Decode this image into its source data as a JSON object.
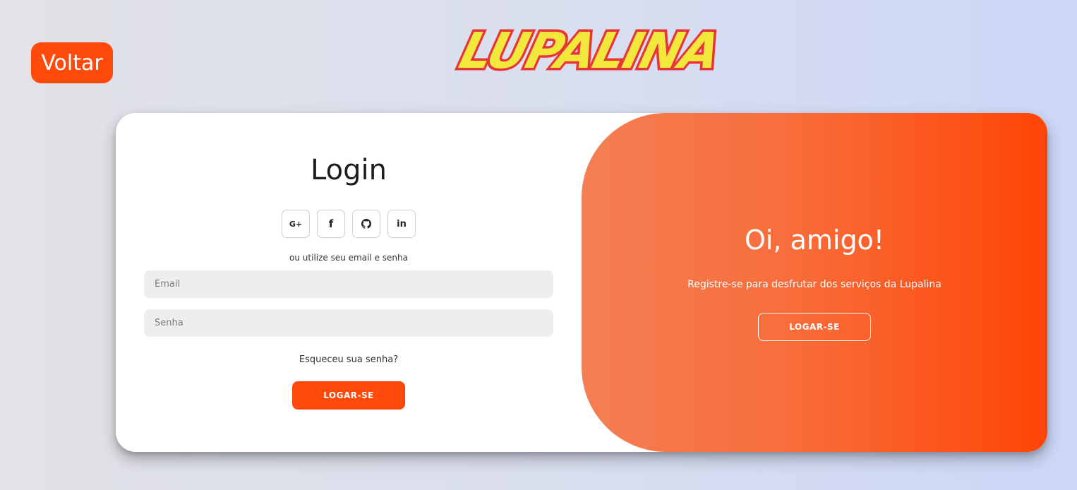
{
  "header": {
    "back_label": "Voltar",
    "logo_text": "LUPALINA"
  },
  "login": {
    "title": "Login",
    "social": [
      {
        "icon": "google-plus-icon",
        "label": "G+"
      },
      {
        "icon": "facebook-icon",
        "label": "f"
      },
      {
        "icon": "github-icon",
        "label": ""
      },
      {
        "icon": "linkedin-icon",
        "label": "in"
      }
    ],
    "alt_text": "ou utilize seu email e senha",
    "email_placeholder": "Email",
    "password_placeholder": "Senha",
    "forgot_label": "Esqueceu sua senha?",
    "submit_label": "LOGAR-SE"
  },
  "promo": {
    "title": "Oi, amigo!",
    "text": "Registre-se para desfrutar dos serviços da Lupalina",
    "button_label": "LOGAR-SE"
  },
  "colors": {
    "accent": "#ff4a0c",
    "logo_fill": "#f2e83c",
    "logo_outline": "#e8353a"
  }
}
